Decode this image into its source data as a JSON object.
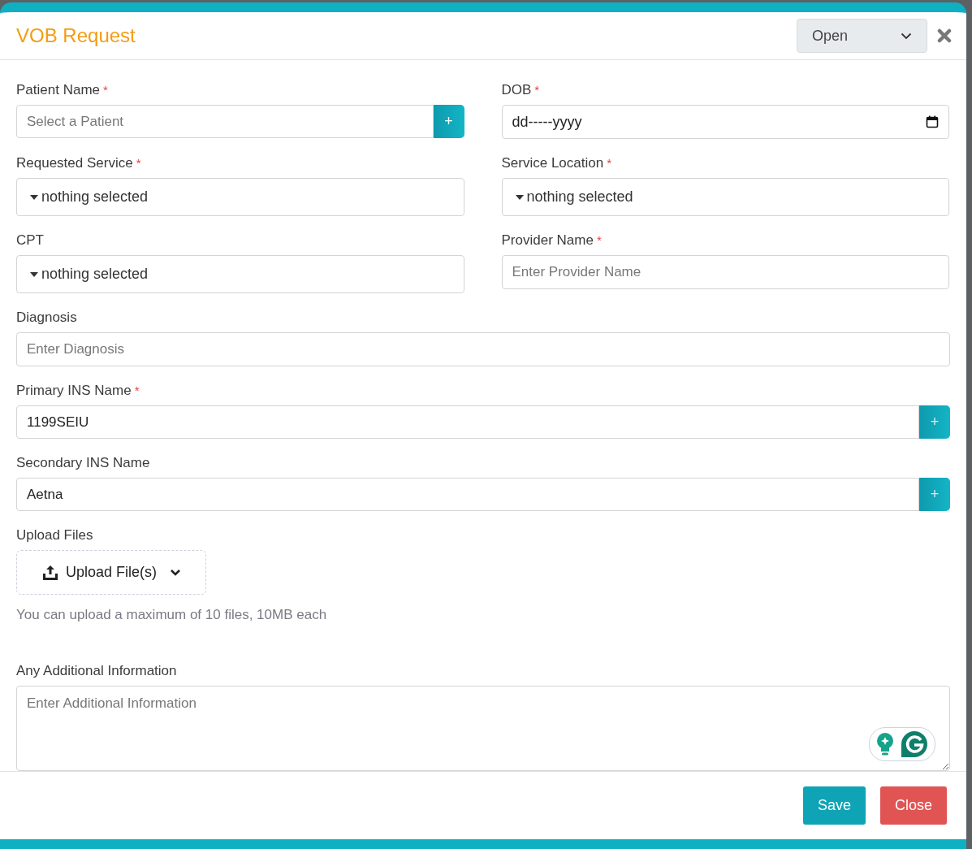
{
  "modal": {
    "title": "VOB Request",
    "status": {
      "value": "Open"
    }
  },
  "grid_fields": [
    {
      "kind": "lookup",
      "label": "Patient Name",
      "required_mark": "*",
      "placeholder": "Select a Patient",
      "button": "+"
    },
    {
      "kind": "date",
      "label": "DOB",
      "required_mark": "*",
      "value": "dd-----yyyy"
    },
    {
      "kind": "dropdown",
      "label": "Requested Service",
      "required_mark": "*",
      "value": "nothing selected"
    },
    {
      "kind": "dropdown",
      "label": "Service Location",
      "required_mark": "*",
      "value": "nothing selected"
    },
    {
      "kind": "dropdown",
      "label": "CPT",
      "value": "nothing selected"
    },
    {
      "kind": "text",
      "label": "Provider Name",
      "required_mark": "*",
      "placeholder": "Enter Provider Name"
    }
  ],
  "wide_fields": [
    {
      "kind": "text",
      "label": "Diagnosis",
      "placeholder": "Enter Diagnosis"
    },
    {
      "kind": "lookup",
      "label": "Primary INS Name",
      "required_mark": "*",
      "value": "1199SEIU",
      "button": "+"
    },
    {
      "kind": "lookup",
      "label": "Secondary INS Name",
      "value": "Aetna",
      "button": "+"
    },
    {
      "kind": "upload",
      "label": "Upload Files",
      "button": "Upload File(s)",
      "hint": "You can upload a maximum of 10 files, 10MB each"
    },
    {
      "kind": "textarea",
      "label": "Any Additional Information",
      "placeholder": "Enter Additional Information"
    }
  ],
  "footer_buttons": [
    {
      "kind": "primary",
      "label": "Save"
    },
    {
      "kind": "danger",
      "label": "Close"
    }
  ]
}
